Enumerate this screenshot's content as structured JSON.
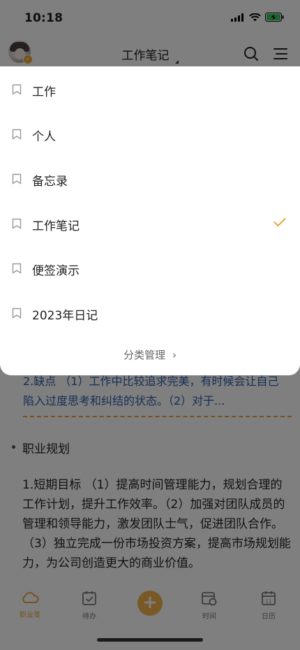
{
  "status_bar": {
    "time": "10:18"
  },
  "header": {
    "title": "工作笔记"
  },
  "categories": [
    {
      "label": "工作",
      "selected": false
    },
    {
      "label": "个人",
      "selected": false
    },
    {
      "label": "备忘录",
      "selected": false
    },
    {
      "label": "工作笔记",
      "selected": true
    },
    {
      "label": "便签演示",
      "selected": false
    },
    {
      "label": "2023年日记",
      "selected": false
    }
  ],
  "manage_label": "分类管理",
  "content": {
    "prev_text": "2.缺点 （1）工作中比较追求完美，有时候会让自己陷入过度思考和纠结的状态。（2）对于...",
    "section_title": "职业规划",
    "body": "1.短期目标 （1）提高时间管理能力，规划合理的工作计划，提升工作效率。（2）加强对团队成员的管理和领导能力，激发团队士气，促进团队合作。（3）独立完成一份市场投资方案，提高市场规划能力，为公司创造更大的商业价值。"
  },
  "tabbar": {
    "items": [
      {
        "label": "职业笺",
        "icon": "cloud-icon",
        "active": true
      },
      {
        "label": "待办",
        "icon": "checkbox-calendar-icon",
        "active": false
      },
      {
        "label": "时间",
        "icon": "clock-calendar-icon",
        "active": false
      },
      {
        "label": "日历",
        "icon": "calendar-icon",
        "active": false
      }
    ],
    "add_icon": "plus-icon"
  },
  "colors": {
    "accent": "#e9a640",
    "link_blue": "#2f5ea8",
    "overlay": "rgba(0,0,0,0.5)"
  }
}
